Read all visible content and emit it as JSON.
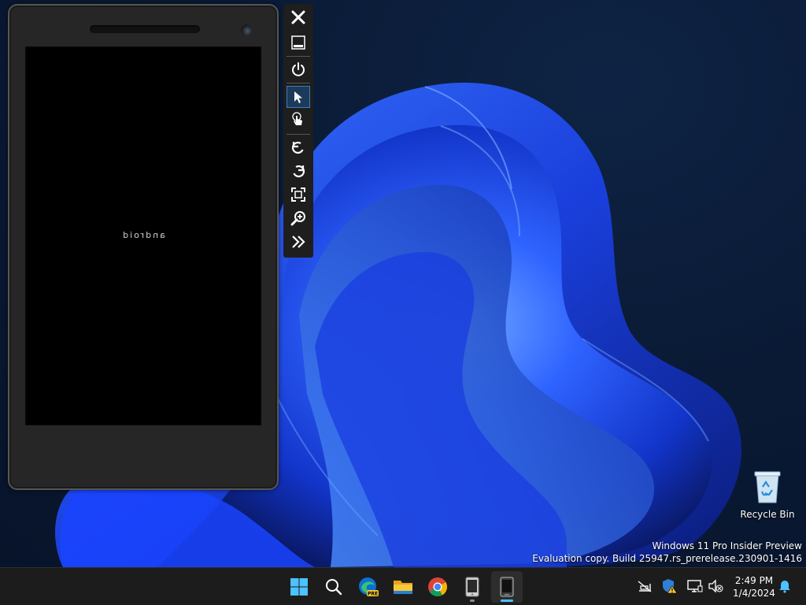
{
  "emulator": {
    "boot_logo": "android",
    "toolbar": {
      "buttons": [
        "close",
        "minimize",
        "power",
        "mouse-input",
        "touch-input",
        "rotate-left",
        "rotate-right",
        "fit-to-screen",
        "zoom",
        "more-tools"
      ],
      "active": "mouse-input"
    }
  },
  "desktop": {
    "recycle_bin_label": "Recycle Bin",
    "watermark": {
      "line1": "Windows 11 Pro Insider Preview",
      "line2": "Evaluation copy. Build 25947.rs_prerelease.230901-1416"
    }
  },
  "taskbar": {
    "apps": [
      "start",
      "search",
      "edge-preview",
      "file-explorer",
      "chrome",
      "device-manager",
      "emulator"
    ],
    "edge_badge": "PRE",
    "tray_icons": [
      "network-off",
      "security-warning",
      "display",
      "volume-muted"
    ],
    "time": "2:49 PM",
    "date": "1/4/2024"
  },
  "colors": {
    "accent": "#4cc2ff",
    "wallpaper_blue": "#1f4cff",
    "taskbar_bg": "#1c1c1c",
    "skin": "#262626"
  }
}
